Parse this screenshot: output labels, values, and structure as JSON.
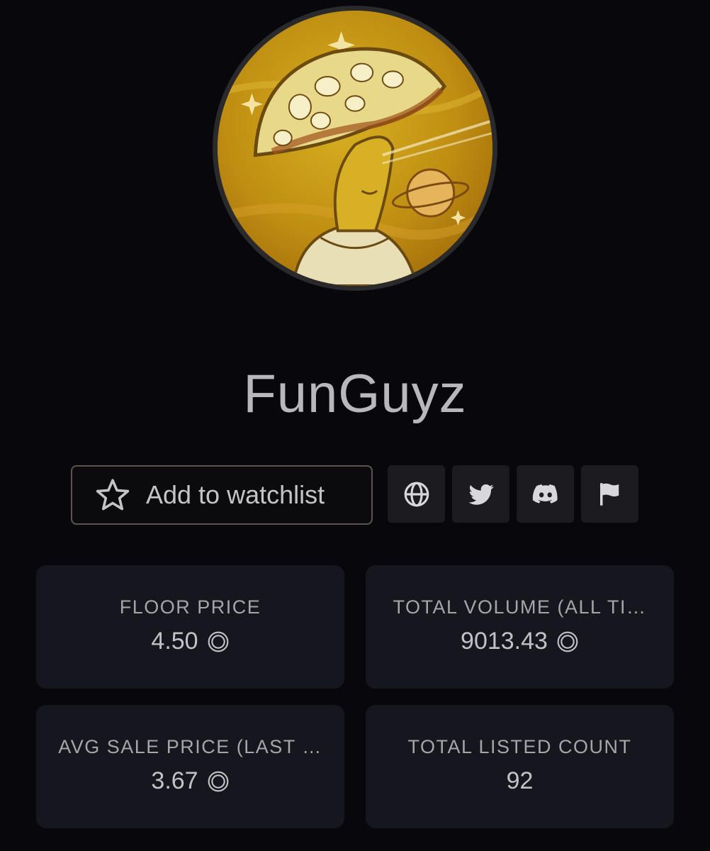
{
  "collection": {
    "name": "FunGuyz",
    "avatar_icon": "mushroom-astronaut-avatar"
  },
  "actions": {
    "watchlist_label": "Add to watchlist",
    "watchlist_icon": "star-outline-icon",
    "links": [
      {
        "name": "website",
        "icon": "globe-icon"
      },
      {
        "name": "twitter",
        "icon": "twitter-icon"
      },
      {
        "name": "discord",
        "icon": "discord-icon"
      },
      {
        "name": "report",
        "icon": "flag-icon"
      }
    ]
  },
  "stats": [
    {
      "label": "FLOOR PRICE",
      "value": "4.50",
      "currency_icon": "sol-circle-icon"
    },
    {
      "label": "TOTAL VOLUME (ALL TI…",
      "value": "9013.43",
      "currency_icon": "sol-circle-icon"
    },
    {
      "label": "AVG SALE PRICE (LAST …",
      "value": "3.67",
      "currency_icon": "sol-circle-icon"
    },
    {
      "label": "TOTAL LISTED COUNT",
      "value": "92"
    }
  ],
  "colors": {
    "background": "#08080c",
    "card": "#16161e",
    "icon_button": "#1c1c20",
    "text": "#b9b9bd",
    "avatar_gold": "#c9a018"
  }
}
